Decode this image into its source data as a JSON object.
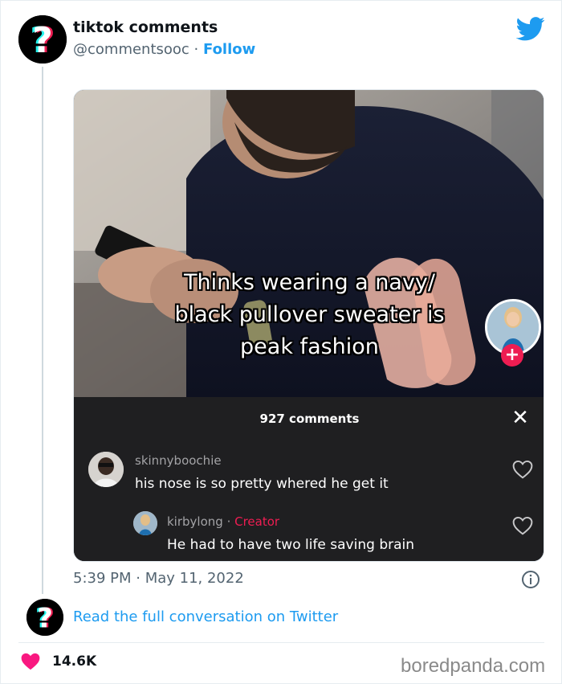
{
  "tweet": {
    "display_name": "tiktok comments",
    "handle": "@commentsooc",
    "separator": " · ",
    "follow_label": "Follow",
    "timestamp": "5:39 PM · May 11, 2022",
    "read_more": "Read the full conversation on Twitter",
    "like_count": "14.6K"
  },
  "media": {
    "caption_lines": [
      "Thinks wearing a navy/",
      "black pullover sweater is",
      "peak fashion"
    ],
    "comments_header": "927 comments",
    "close_glyph": "✕",
    "follow_plus": "+",
    "comments": [
      {
        "user": "skinnyboochie",
        "text": "his nose is so pretty whered he get it"
      },
      {
        "user": "kirbylong",
        "creator_sep": " · ",
        "creator_label": "Creator",
        "text": "He had to have two life saving brain"
      }
    ]
  },
  "watermark": "boredpanda.com",
  "colors": {
    "twitter_blue": "#1d9bf0",
    "like_red": "#f91880",
    "tiktok_red": "#ee1d52",
    "tiktok_cyan": "#25f4ee"
  },
  "icons": [
    "question-mark-avatar-icon",
    "twitter-bird-icon",
    "heart-outline-icon",
    "info-icon",
    "heart-filled-icon",
    "close-icon",
    "plus-icon"
  ]
}
